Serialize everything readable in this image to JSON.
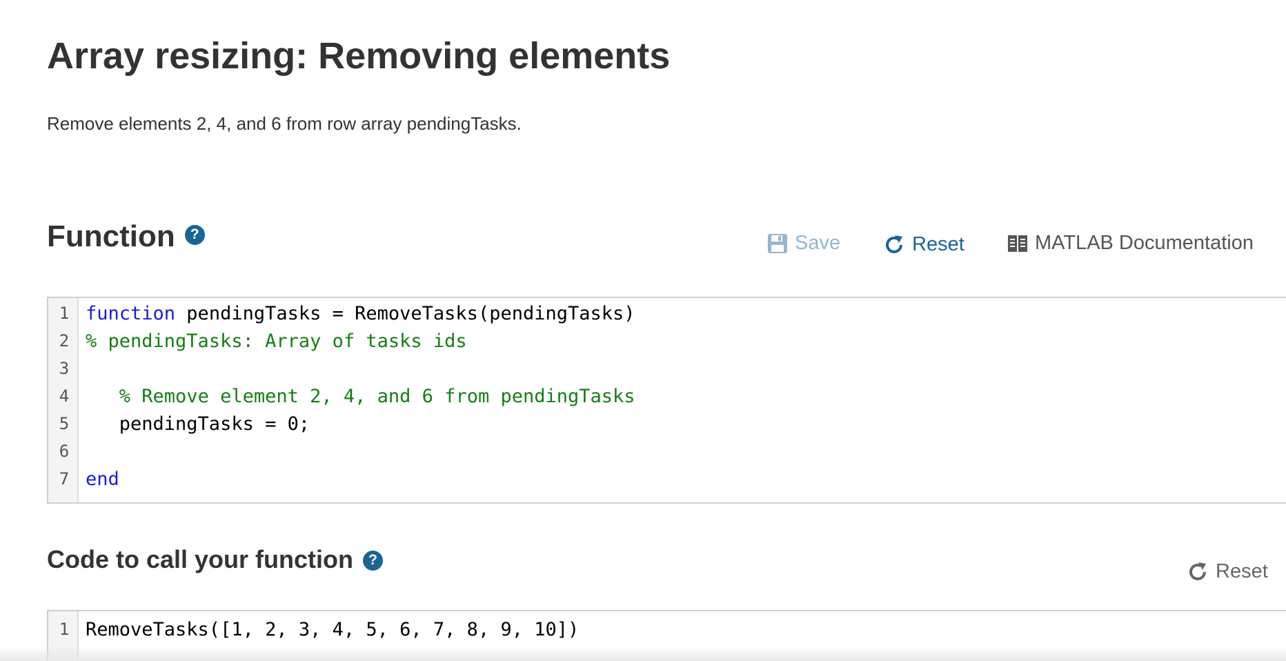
{
  "page": {
    "title": "Array resizing: Removing elements",
    "prompt": "Remove elements 2, 4, and 6 from row array pendingTasks."
  },
  "function_section": {
    "heading": "Function",
    "help_icon": "question-circle-icon",
    "toolbar": {
      "save_label": "Save",
      "reset_label": "Reset",
      "docs_label": "MATLAB Documentation"
    },
    "lines": [
      {
        "no": "1",
        "parts": [
          {
            "t": "kw",
            "text": "function"
          },
          {
            "t": "plain",
            "text": " pendingTasks = RemoveTasks(pendingTasks)"
          }
        ]
      },
      {
        "no": "2",
        "parts": [
          {
            "t": "cm",
            "text": "% pendingTasks: Array of tasks ids"
          }
        ]
      },
      {
        "no": "3",
        "parts": []
      },
      {
        "no": "4",
        "parts": [
          {
            "t": "plain",
            "text": "   "
          },
          {
            "t": "cm",
            "text": "% Remove element 2, 4, and 6 from pendingTasks"
          }
        ]
      },
      {
        "no": "5",
        "parts": [
          {
            "t": "plain",
            "text": "   pendingTasks = 0;"
          }
        ]
      },
      {
        "no": "6",
        "parts": []
      },
      {
        "no": "7",
        "parts": [
          {
            "t": "kw",
            "text": "end"
          }
        ]
      }
    ]
  },
  "call_section": {
    "heading": "Code to call your function",
    "help_icon": "question-circle-icon",
    "reset_label": "Reset",
    "lines": [
      {
        "no": "1",
        "parts": [
          {
            "t": "plain",
            "text": "RemoveTasks([1, 2, 3, 4, 5, 6, 7, 8, 9, 10])"
          }
        ]
      }
    ]
  },
  "colors": {
    "accent": "#1a6496",
    "save_disabled": "#93b7d3",
    "keyword": "#1b1be0",
    "comment": "#138013"
  }
}
